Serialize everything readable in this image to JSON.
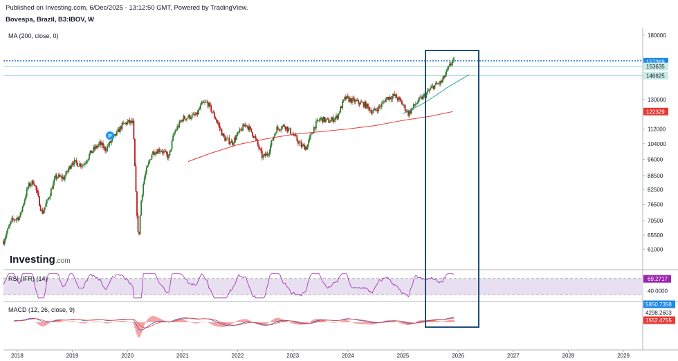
{
  "header": {
    "published": "Published on Investing.com, 6/Dec/2025 - 13:12:50 GMT, Powered by TradingView.",
    "symbol": "Bovespa, Brazil, B3:IBOV, W"
  },
  "brand": {
    "name": "Investing",
    "suffix": ".com"
  },
  "colors": {
    "up": "#26a69a",
    "down": "#b71c1c",
    "candle_body": "#2e7d32",
    "ma": "#e53935",
    "rsi": "#9c27b0",
    "rsi_band": "#e8dff0",
    "macd": "#3f51b5",
    "signal": "#f44336",
    "hist": "#f5a3a3",
    "highlight_box": "#1f4e79",
    "trendline": "#26a69a"
  },
  "chart_data": [
    {
      "type": "line",
      "title": "Bovespa, Brazil, B3:IBOV, W",
      "indicator_label": "MA (200, close, 0)",
      "x_ticks": [
        "2018",
        "2019",
        "2020",
        "2021",
        "2022",
        "2023",
        "2024",
        "2025",
        "2026",
        "2027",
        "2028",
        "2029"
      ],
      "y_ticks": [
        180000,
        160000,
        146000,
        130000,
        122000,
        112000,
        104000,
        96000,
        88500,
        82500,
        76500,
        70500,
        65500,
        61000
      ],
      "y_tick_labels": [
        "180000",
        "",
        "",
        "130000",
        "",
        "112000",
        "104000",
        "96000",
        "88500",
        "82500",
        "76500",
        "70500",
        "65500",
        "61000"
      ],
      "price_labels": [
        {
          "text": "158446",
          "style": "line"
        },
        {
          "text": "157369",
          "style": "badge"
        },
        {
          "text": "153635",
          "style": "light"
        },
        {
          "text": "146625",
          "style": "light"
        },
        {
          "text": "122329",
          "style": "ma"
        }
      ],
      "series": [
        {
          "name": "IBOV",
          "x": [
            2017.75,
            2017.9,
            2018.05,
            2018.2,
            2018.3,
            2018.45,
            2018.55,
            2018.7,
            2018.85,
            2019.0,
            2019.1,
            2019.2,
            2019.35,
            2019.5,
            2019.6,
            2019.75,
            2019.9,
            2020.0,
            2020.1,
            2020.15,
            2020.2,
            2020.25,
            2020.3,
            2020.45,
            2020.6,
            2020.75,
            2020.85,
            2021.0,
            2021.1,
            2021.25,
            2021.35,
            2021.45,
            2021.6,
            2021.75,
            2021.9,
            2022.0,
            2022.15,
            2022.3,
            2022.45,
            2022.55,
            2022.7,
            2022.85,
            2023.0,
            2023.15,
            2023.25,
            2023.4,
            2023.5,
            2023.65,
            2023.8,
            2023.95,
            2024.1,
            2024.3,
            2024.45,
            2024.6,
            2024.7,
            2024.85,
            2024.95,
            2025.1,
            2025.25,
            2025.4,
            2025.55,
            2025.7,
            2025.8,
            2025.9
          ],
          "y": [
            63500,
            70500,
            72000,
            84000,
            86000,
            73000,
            78000,
            88000,
            87500,
            95000,
            94000,
            93500,
            100000,
            104000,
            101000,
            107000,
            114000,
            116000,
            115500,
            82000,
            63000,
            78000,
            87000,
            99500,
            101000,
            97000,
            110000,
            118000,
            119000,
            120000,
            127000,
            128000,
            118000,
            107000,
            104500,
            109000,
            115000,
            108000,
            97000,
            99000,
            112000,
            114000,
            109000,
            103000,
            102000,
            114000,
            118000,
            116500,
            119000,
            131000,
            129000,
            127000,
            122000,
            126000,
            131000,
            132500,
            129000,
            121000,
            128000,
            133000,
            139000,
            142000,
            150000,
            158446
          ]
        },
        {
          "name": "MA (200, close, 0)",
          "x": [
            2021.1,
            2021.5,
            2022.0,
            2022.5,
            2023.0,
            2023.5,
            2024.0,
            2024.5,
            2025.0,
            2025.5,
            2025.9
          ],
          "y": [
            95000,
            99000,
            103500,
            106500,
            109000,
            110500,
            112000,
            114000,
            117000,
            119500,
            122329
          ]
        },
        {
          "name": "trend",
          "x": [
            2025.0,
            2025.4,
            2025.8,
            2026.2
          ],
          "y": [
            121000,
            128000,
            138000,
            147500
          ]
        }
      ]
    },
    {
      "type": "line",
      "title": "RSI (IFR) (14)",
      "y_ticks": [
        60,
        40
      ],
      "y_tick_labels": [
        "",
        "40.0000"
      ],
      "value_label": "69.2717",
      "series": [
        {
          "name": "RSI (IFR) (14)",
          "last": 69.2717
        }
      ]
    },
    {
      "type": "line",
      "title": "MACD (12, 26, close, 9)",
      "value_labels": [
        "5850.7358",
        "4298.2603",
        "1552.4755"
      ],
      "series": [
        {
          "name": "MACD",
          "last": 5850.7358
        },
        {
          "name": "Signal",
          "last": 4298.2603
        },
        {
          "name": "Histogram",
          "last": 1552.4755
        }
      ]
    }
  ]
}
